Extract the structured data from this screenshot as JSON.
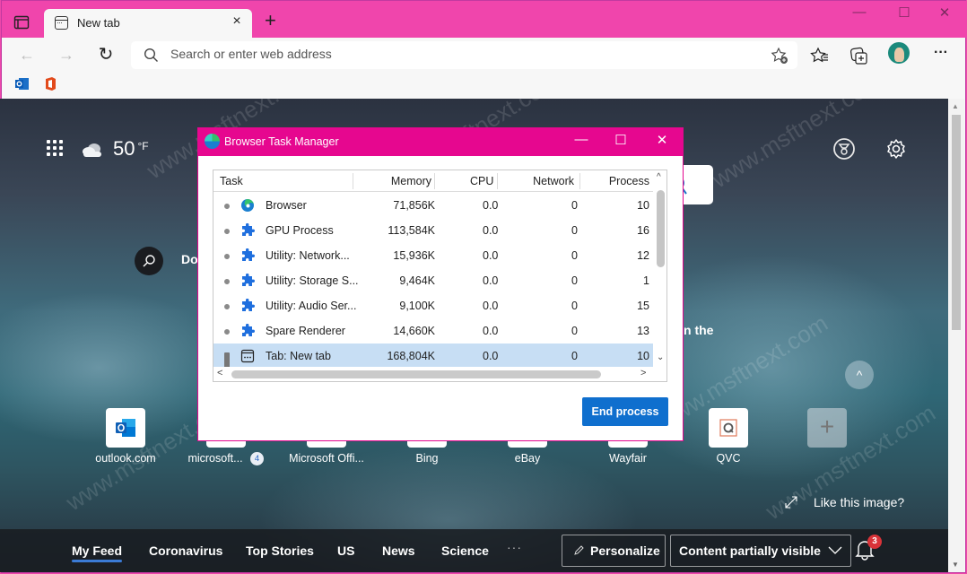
{
  "browser": {
    "tab": {
      "title": "New tab",
      "close": "×"
    },
    "new_tab": "+",
    "window_controls": {
      "minimize": "—",
      "maximize": "☐",
      "close": "✕"
    },
    "nav": {
      "back": "←",
      "forward": "→",
      "refresh": "↻"
    },
    "address_bar": {
      "placeholder": "Search or enter web address",
      "value": ""
    },
    "toolbar_icons": [
      "add-favorite-icon",
      "favorites-icon",
      "collections-icon",
      "profile-avatar",
      "more-icon"
    ],
    "more_label": "···",
    "favorites": [
      "outlook",
      "office"
    ],
    "accent_color": "#f045ac"
  },
  "new_tab_page": {
    "weather": {
      "temp": "50",
      "unit": "°F"
    },
    "search_prompt_partial": "Do",
    "caption_partial": "n the",
    "quick_links": [
      {
        "label": "outlook.com"
      },
      {
        "label": "microsoft...",
        "badge": "4"
      },
      {
        "label": "Microsoft Offi..."
      },
      {
        "label": "Bing"
      },
      {
        "label": "eBay"
      },
      {
        "label": "Wayfair"
      },
      {
        "label": "QVC"
      }
    ],
    "add_tile": "+",
    "like_image": "Like this image?",
    "scroll_up": "^",
    "feed": {
      "tabs": [
        "My Feed",
        "Coronavirus",
        "Top Stories",
        "US",
        "News",
        "Science"
      ],
      "active_tab": "My Feed",
      "more": "···",
      "personalize": "Personalize",
      "content_visibility": "Content partially visible",
      "notifications_count": "3"
    }
  },
  "task_manager": {
    "title": "Browser Task Manager",
    "window_controls": {
      "minimize": "—",
      "maximize": "☐",
      "close": "✕"
    },
    "columns": [
      "Task",
      "Memory",
      "CPU",
      "Network",
      "Process"
    ],
    "rows": [
      {
        "icon": "edge",
        "task": "Browser",
        "memory": "71,856K",
        "cpu": "0.0",
        "network": "0",
        "process": "10"
      },
      {
        "icon": "puzzle",
        "task": "GPU Process",
        "memory": "113,584K",
        "cpu": "0.0",
        "network": "0",
        "process": "16"
      },
      {
        "icon": "puzzle",
        "task": "Utility: Network...",
        "memory": "15,936K",
        "cpu": "0.0",
        "network": "0",
        "process": "12"
      },
      {
        "icon": "puzzle",
        "task": "Utility: Storage S...",
        "memory": "9,464K",
        "cpu": "0.0",
        "network": "0",
        "process": "1"
      },
      {
        "icon": "puzzle",
        "task": "Utility: Audio Ser...",
        "memory": "9,100K",
        "cpu": "0.0",
        "network": "0",
        "process": "15"
      },
      {
        "icon": "puzzle",
        "task": "Spare Renderer",
        "memory": "14,660K",
        "cpu": "0.0",
        "network": "0",
        "process": "13"
      },
      {
        "icon": "tab",
        "task": "Tab: New tab",
        "memory": "168,804K",
        "cpu": "0.0",
        "network": "0",
        "process": "10",
        "selected": true
      }
    ],
    "end_process": "End process",
    "accent_color": "#e6078f",
    "button_color": "#0f6fce"
  },
  "watermark": "www.msftnext.com"
}
